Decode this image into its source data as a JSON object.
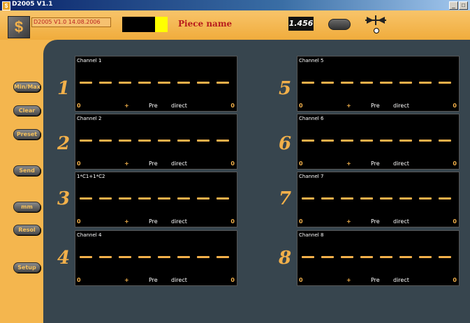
{
  "window": {
    "title": "D2005 V1.1",
    "icon": "app-icon",
    "buttons": [
      "_",
      "□"
    ]
  },
  "header": {
    "version": "D2005 V1.0 14.08.2006",
    "piece_label": "Piece name",
    "value": "1.456",
    "icons": [
      "logo-icon",
      "calibration-icon"
    ]
  },
  "colors": {
    "accent": "#f2b04a",
    "background": "#f4b64e",
    "panel": "#37454e",
    "display": "#000000",
    "title": "#b81c1c",
    "indicator": "#ffff00"
  },
  "sidebar": {
    "buttons": [
      {
        "label": "Min/Max"
      },
      {
        "label": "Clear"
      },
      {
        "label": "Preset"
      },
      {
        "label": "Send"
      },
      {
        "label": "mm"
      },
      {
        "label": "Resol"
      },
      {
        "label": "Setup"
      }
    ]
  },
  "channels": [
    {
      "num": "1",
      "label": "Channel 1",
      "left": "0",
      "sign": "+",
      "mode": "Pre",
      "type": "direct",
      "right": "0"
    },
    {
      "num": "2",
      "label": "Channel 2",
      "left": "0",
      "sign": "+",
      "mode": "Pre",
      "type": "direct",
      "right": "0"
    },
    {
      "num": "3",
      "label": "1*C1+1*C2",
      "left": "0",
      "sign": "+",
      "mode": "Pre",
      "type": "direct",
      "right": "0"
    },
    {
      "num": "4",
      "label": "Channel 4",
      "left": "0",
      "sign": "+",
      "mode": "Pre",
      "type": "direct",
      "right": "0"
    },
    {
      "num": "5",
      "label": "Channel 5",
      "left": "0",
      "sign": "+",
      "mode": "Pre",
      "type": "direct",
      "right": "0"
    },
    {
      "num": "6",
      "label": "Channel 6",
      "left": "0",
      "sign": "+",
      "mode": "Pre",
      "type": "direct",
      "right": "0"
    },
    {
      "num": "7",
      "label": "Channel 7",
      "left": "0",
      "sign": "+",
      "mode": "Pre",
      "type": "direct",
      "right": "0"
    },
    {
      "num": "8",
      "label": "Channel 8",
      "left": "0",
      "sign": "+",
      "mode": "Pre",
      "type": "direct",
      "right": "0"
    }
  ]
}
